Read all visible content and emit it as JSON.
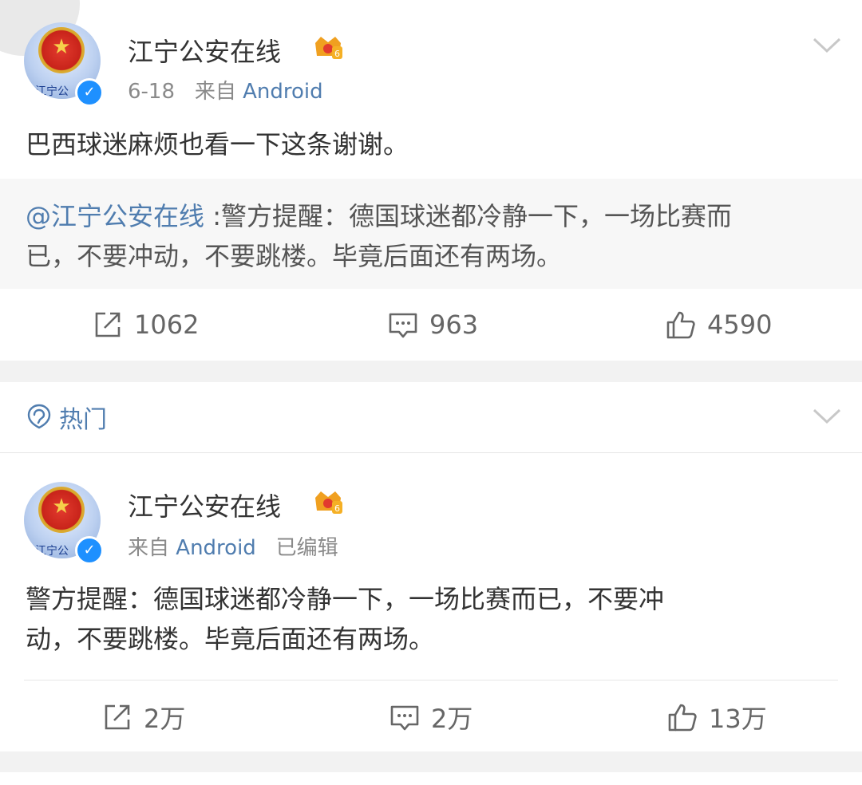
{
  "posts": [
    {
      "user": {
        "name": "江宁公安在线",
        "avatar_label": "江宁公"
      },
      "meta": {
        "date": "6-18",
        "from": "来自",
        "source": "Android"
      },
      "text": "巴西球迷麻烦也看一下这条谢谢。",
      "repost": {
        "mention": "@江宁公安在线",
        "line1": " :警方提醒：德国球迷都冷静一下，一场比赛而",
        "line2": "已，不要冲动，不要跳楼。毕竟后面还有两场。"
      },
      "actions": {
        "repost": "1062",
        "comment": "963",
        "like": "4590"
      }
    },
    {
      "user": {
        "name": "江宁公安在线",
        "avatar_label": "江宁公"
      },
      "meta": {
        "from": "来自",
        "source": "Android",
        "edited": "已编辑"
      },
      "text_line1": "警方提醒：德国球迷都冷静一下，一场比赛而已，不要冲",
      "text_line2": "动，不要跳楼。毕竟后面还有两场。",
      "actions": {
        "repost": "2万",
        "comment": "2万",
        "like": "13万"
      }
    }
  ],
  "hot_section": {
    "label": "热门",
    "icon": "hot-topic-icon"
  },
  "icons": {
    "dropdown": "chevron-down-icon",
    "repost": "repost-icon",
    "comment": "comment-icon",
    "like": "thumbs-up-icon",
    "verified": "verified-badge-icon",
    "vip": "crown-icon"
  },
  "colors": {
    "link": "#507daf",
    "text": "#333333",
    "meta": "#8a8a8a",
    "verified": "#1e90ff",
    "crown": "#f0a020"
  }
}
